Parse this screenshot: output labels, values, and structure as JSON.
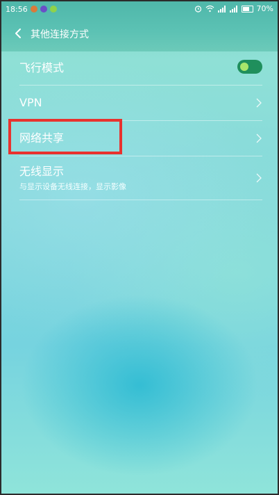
{
  "status_bar": {
    "time": "18:56",
    "battery_text": "70%",
    "icons": [
      "app-icon-1",
      "app-icon-2",
      "app-icon-3",
      "alarm-icon",
      "wifi-icon",
      "signal-icon",
      "signal-icon-2",
      "battery-icon"
    ]
  },
  "header": {
    "title": "其他连接方式",
    "back_icon": "chevron-left-icon"
  },
  "settings": {
    "items": [
      {
        "label": "飞行模式",
        "control": "toggle",
        "toggle_on": true
      },
      {
        "label": "VPN",
        "control": "chevron"
      },
      {
        "label": "网络共享",
        "control": "chevron"
      },
      {
        "label": "无线显示",
        "sublabel": "与显示设备无线连接，显示影像",
        "control": "chevron"
      }
    ]
  },
  "annotation": {
    "highlight_color": "#e8322e"
  },
  "colors": {
    "toggle_track": "#1f8f5c",
    "toggle_knob": "#a8e66b"
  }
}
